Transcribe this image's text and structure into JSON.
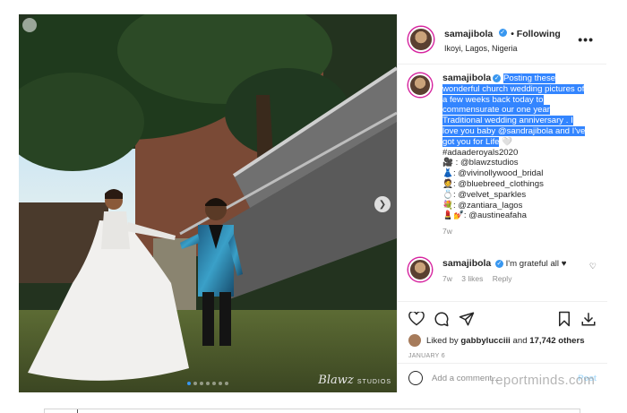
{
  "post": {
    "author": {
      "username": "samajibola",
      "follow_status": "• Following",
      "location": "Ikoyi, Lagos, Nigeria",
      "more_icon": "ellipsis-icon"
    },
    "photo": {
      "signature": "Blawz",
      "signature_suffix": "STUDIOS",
      "carousel_count": 7,
      "carousel_active": 1
    },
    "caption": {
      "username": "samajibola",
      "highlighted_lines": [
        "Posting these",
        "wonderful church wedding pictures of",
        "a few weeks back today to",
        "commensurate our one year",
        "Traditional wedding anniversary . I",
        "love you baby @sandrajibola and I've",
        "got you for Life"
      ],
      "lines": [
        "#adaaderoyals2020",
        "🎥 : @blawzstudios",
        "👗: @vivinollywood_bridal",
        "🤵: @bluebreed_clothings",
        "💍: @velvet_sparkles",
        "💐: @zantiara_lagos",
        "💄💅: @austineafaha"
      ],
      "time": "7w"
    },
    "reply": {
      "username": "samajibola",
      "text": "I'm grateful all ♥",
      "time": "7w",
      "likes": "3 likes",
      "reply_label": "Reply"
    },
    "actions": {
      "liked_by_prefix": "Liked by",
      "liked_by_user": "gabbylucciii",
      "liked_by_and": "and",
      "liked_by_others": "17,742 others",
      "date": "JANUARY 6"
    },
    "add_comment": {
      "placeholder": "Add a comment...",
      "post_label": "Post"
    }
  },
  "watermark": "reportminds.com",
  "colors": {
    "accent": "#3897f0",
    "highlight": "#3385ff",
    "text": "#262626",
    "muted": "#8e8e8e"
  }
}
